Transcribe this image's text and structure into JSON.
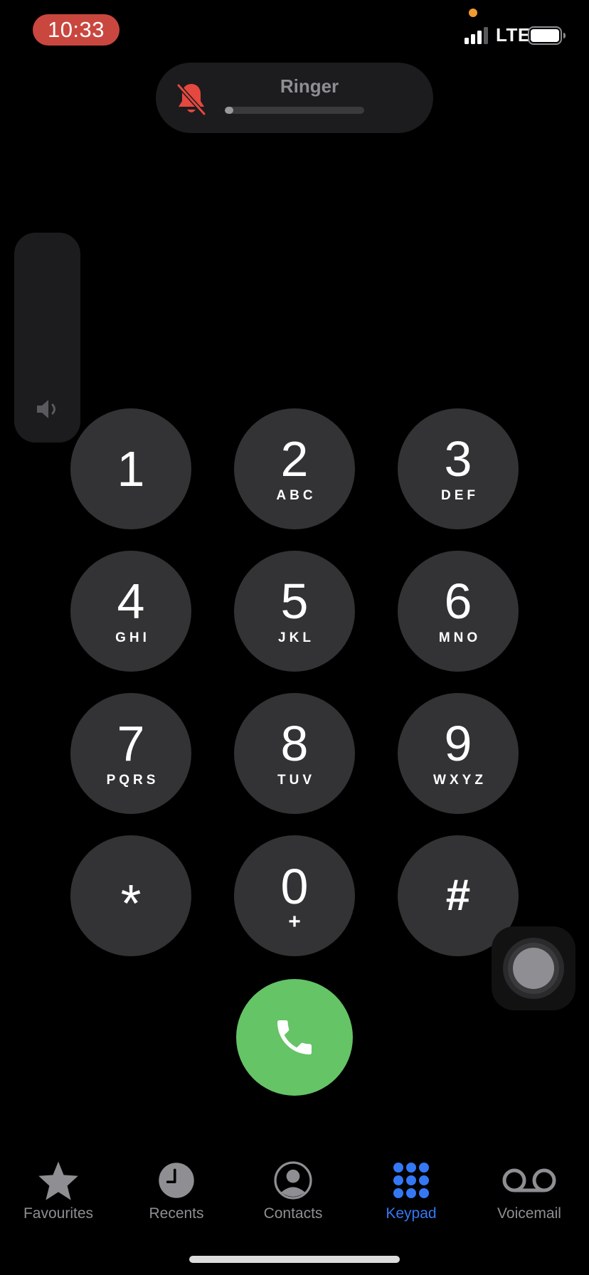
{
  "status_bar": {
    "time": "10:33",
    "network": "LTE",
    "time_pill_color": "#c9473f",
    "privacy_dot_color": "#f39b31"
  },
  "ringer_hud": {
    "label": "Ringer",
    "muted": true,
    "volume_fraction": 0.06,
    "icon": "bell-slash-icon",
    "icon_color": "#e5483f"
  },
  "volume_hud": {
    "icon": "speaker-icon",
    "level_fraction": 0
  },
  "keypad": {
    "keys": [
      {
        "digit": "1",
        "letters": ""
      },
      {
        "digit": "2",
        "letters": "ABC"
      },
      {
        "digit": "3",
        "letters": "DEF"
      },
      {
        "digit": "4",
        "letters": "GHI"
      },
      {
        "digit": "5",
        "letters": "JKL"
      },
      {
        "digit": "6",
        "letters": "MNO"
      },
      {
        "digit": "7",
        "letters": "PQRS"
      },
      {
        "digit": "8",
        "letters": "TUV"
      },
      {
        "digit": "9",
        "letters": "WXYZ"
      },
      {
        "digit": "*",
        "letters": ""
      },
      {
        "digit": "0",
        "letters": "+"
      },
      {
        "digit": "#",
        "letters": ""
      }
    ],
    "call_button_color": "#65c466",
    "call_icon": "phone-icon"
  },
  "tab_bar": {
    "items": [
      {
        "label": "Favourites",
        "icon": "star-icon",
        "active": false
      },
      {
        "label": "Recents",
        "icon": "clock-icon",
        "active": false
      },
      {
        "label": "Contacts",
        "icon": "person-circle-icon",
        "active": false
      },
      {
        "label": "Keypad",
        "icon": "keypad-grid-icon",
        "active": true
      },
      {
        "label": "Voicemail",
        "icon": "voicemail-icon",
        "active": false
      }
    ],
    "active_color": "#3478f6",
    "inactive_color": "#8e8e93"
  }
}
